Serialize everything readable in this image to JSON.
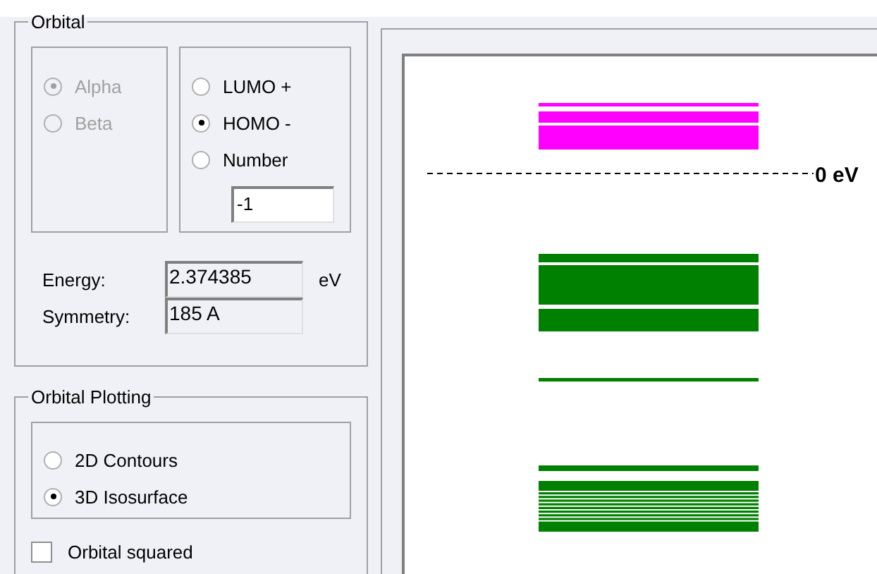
{
  "orbital": {
    "title": "Orbital",
    "spin": [
      {
        "label": "Alpha",
        "selected": true,
        "disabled": true
      },
      {
        "label": "Beta",
        "selected": false,
        "disabled": true
      }
    ],
    "mode": [
      {
        "label": "LUMO +",
        "selected": false
      },
      {
        "label": "HOMO -",
        "selected": true
      },
      {
        "label": "Number",
        "selected": false
      }
    ],
    "number": "-1",
    "energy": {
      "label": "Energy:",
      "value": "2.374385",
      "unit": "eV"
    },
    "symmetry": {
      "label": "Symmetry:",
      "value": "185 A"
    }
  },
  "plotting": {
    "title": "Orbital Plotting",
    "style": [
      {
        "label": "2D Contours",
        "selected": false
      },
      {
        "label": "3D Isosurface",
        "selected": true
      }
    ],
    "squared": {
      "label": "Orbital squared",
      "checked": false
    }
  },
  "diagram": {
    "zero_label": "0 eV"
  }
}
